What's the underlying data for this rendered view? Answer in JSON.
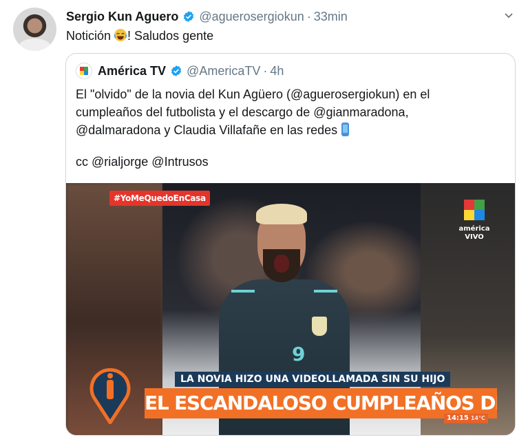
{
  "tweet": {
    "author_name": "Sergio Kun Aguero",
    "handle": "@aguerosergiokun",
    "separator": "·",
    "time": "33min",
    "text": "Notición",
    "text_suffix": "! Saludos gente",
    "emoji": "face-with-tears-of-joy"
  },
  "quote": {
    "author_name": "América TV",
    "handle": "@AmericaTV",
    "separator": "·",
    "time": "4h",
    "lines": [
      "El \"olvido\" de la novia del Kun Agüero (@aguerosergiokun) en el",
      "cumpleaños del futbolista y el descargo de @gianmaradona,",
      "@dalmaradona y Claudia Villafañe en las redes"
    ],
    "cc": "cc @rialjorge @Intrusos"
  },
  "media": {
    "hashtag": "#YoMeQuedoEnCasa",
    "channel_name": "américa",
    "channel_sub": "VIVO",
    "subtitle": "LA NOVIA HIZO UNA VIDEOLLAMADA SIN SU HIJO",
    "headline": "EL ESCANDALOSO CUMPLEAÑOS DE \"EL KUN\" AGÜERO",
    "clock": "14:15",
    "temp": "14°C",
    "jersey_number": "9"
  },
  "colors": {
    "verified": "#1da1f2",
    "secondary_text": "#657786",
    "border": "#ccd6dd",
    "headline_bg": "#f27026",
    "subtitle_bg": "#1b3a5a",
    "hashtag_bg": "#e5352b"
  },
  "icons": {
    "verified": "verified-badge-icon",
    "caret": "chevron-down-icon",
    "phone": "mobile-phone-icon"
  }
}
